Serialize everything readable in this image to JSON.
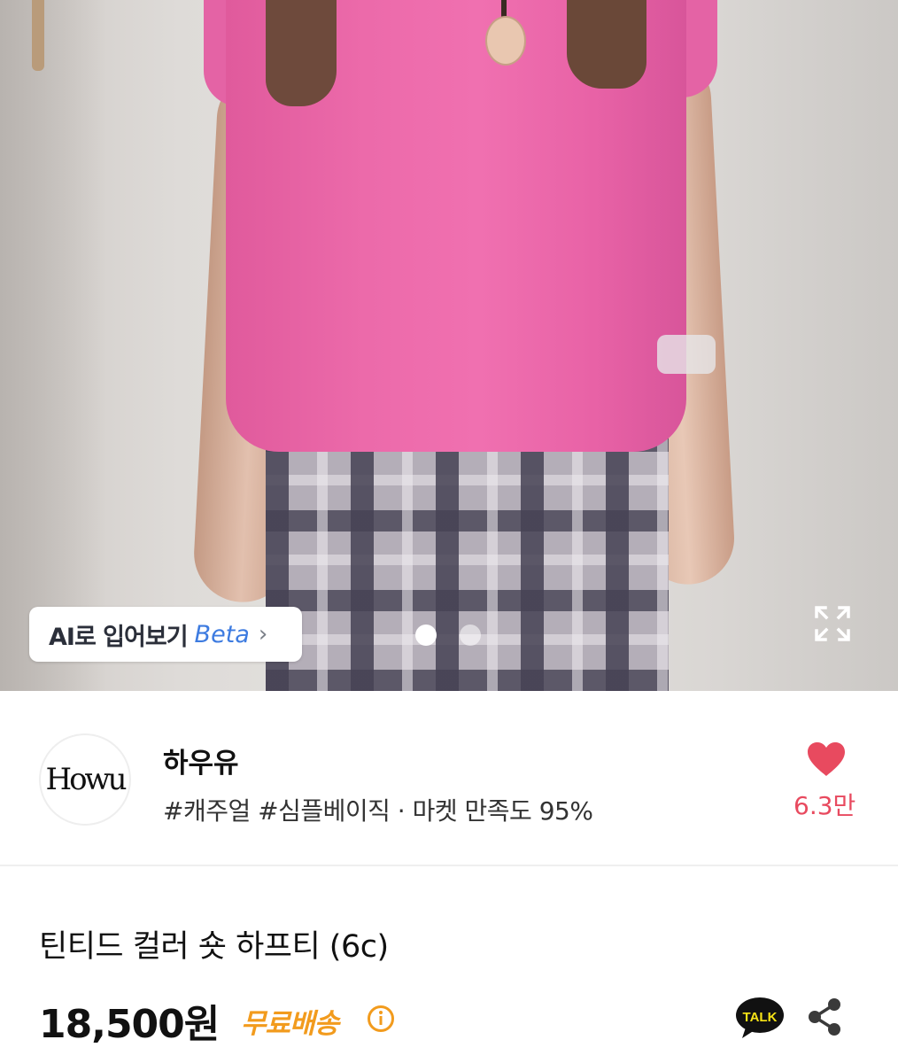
{
  "photo": {
    "ai_button": {
      "label": "AI로 입어보기",
      "beta": "Beta",
      "chevron": "›"
    },
    "carousel": {
      "total": 2,
      "active": 1
    },
    "expand_icon": "expand-icon"
  },
  "shop": {
    "logo_text": "Howu",
    "name": "하우유",
    "tags": "#캐주얼 #심플베이직 · 마켓 만족도 95%",
    "likes": "6.3만"
  },
  "product": {
    "title": "틴티드 컬러 숏 하프티 (6c)",
    "price": "18,500원",
    "shipping": "무료배송",
    "talk_label": "TALK"
  },
  "colors": {
    "accent_heart": "#e84a5f",
    "shipping_orange": "#f29b1d",
    "beta_blue": "#3d7be0",
    "kakao_yellow": "#f7e317"
  }
}
